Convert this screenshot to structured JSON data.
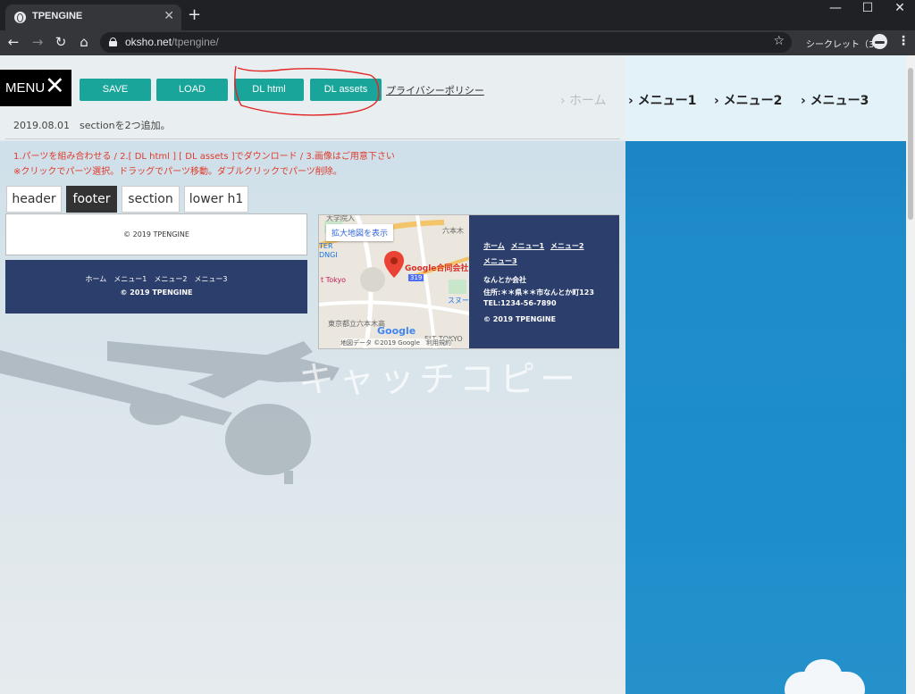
{
  "browser": {
    "tab_title": "TPENGINE",
    "new_tab": "+",
    "url_host": "oksho.net",
    "url_path": "/tpengine/",
    "incognito_label": "シークレット（3）"
  },
  "editor": {
    "menu_label": "MENU",
    "buttons": {
      "save": "SAVE",
      "load": "LOAD",
      "dl_html": "DL html",
      "dl_assets": "DL assets"
    },
    "privacy_link": "プライバシーポリシー",
    "update_log": "2019.08.01　sectionを2つ追加。",
    "instructions": [
      "1.パーツを組み合わせる / 2.[ DL html ] [ DL assets ]でダウンロード / 3.画像はご用意下さい",
      "※クリックでパーツ選択。ドラッグでパーツ移動。ダブルクリックでパーツ削除。"
    ],
    "part_tabs": [
      "header",
      "footer",
      "section",
      "lower h1"
    ],
    "active_tab": "footer"
  },
  "parts": {
    "footer1_copyright": "© 2019 TPENGINE",
    "footer2_nav": "ホーム　メニュー1　メニュー2　メニュー3",
    "footer2_copyright": "© 2019 TPENGINE",
    "map": {
      "enlarge_link": "拡大地図を表示",
      "place_label": "Google合同会社",
      "labels": [
        "大学院入",
        "六本木",
        "TER",
        "DNGI",
        "t Tokyo",
        "スヌー",
        "東京都立六本木高",
        "ELT TOKYO",
        "319"
      ],
      "brand": "Google",
      "footer": "地図データ ©2019 Google　利用規約"
    },
    "footer3": {
      "links": [
        "ホーム",
        "メニュー1",
        "メニュー2",
        "メニュー3"
      ],
      "company": "なんとか会社",
      "address": "住所:＊＊県＊＊市なんとか町123",
      "tel": "TEL:1234-56-7890",
      "copyright": "© 2019 TPENGINE"
    }
  },
  "preview": {
    "catchcopy": "キャッチコピー",
    "nav_home": "› ホーム",
    "nav_items": [
      "› メニュー1",
      "› メニュー2",
      "› メニュー3"
    ]
  }
}
